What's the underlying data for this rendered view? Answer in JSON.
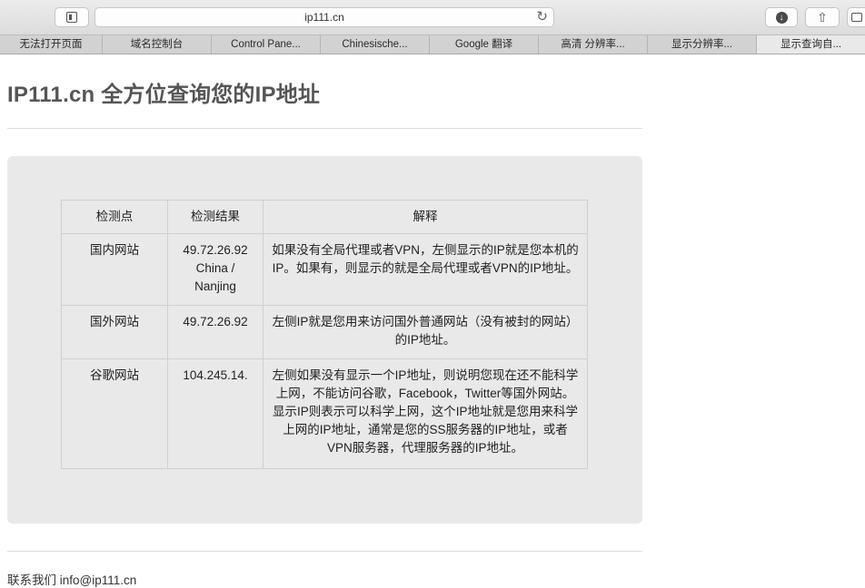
{
  "browser": {
    "url": "ip111.cn",
    "icons": {
      "sidebar": "sidebar-icon",
      "reload": "reload-icon",
      "download": "download-icon",
      "share": "share-icon",
      "tabs": "tabs-icon"
    }
  },
  "bookmarks": [
    {
      "label": "无法打开页面"
    },
    {
      "label": "域名控制台"
    },
    {
      "label": "Control Pane..."
    },
    {
      "label": "Chinesische..."
    },
    {
      "label": "Google 翻译"
    },
    {
      "label": "高清 分辨率..."
    },
    {
      "label": "显示分辨率..."
    },
    {
      "label": "显示查询自..."
    }
  ],
  "page": {
    "title": "IP111.cn 全方位查询您的IP地址",
    "table": {
      "headers": [
        "检测点",
        "检测结果",
        "解释"
      ],
      "rows": [
        {
          "point": "国内网站",
          "ip": "49.72.26.92",
          "location": "China / Nanjing",
          "explanation": "如果没有全局代理或者VPN，左侧显示的IP就是您本机的IP。如果有，则显示的就是全局代理或者VPN的IP地址。"
        },
        {
          "point": "国外网站",
          "ip": "49.72.26.92",
          "location": "",
          "explanation": "左侧IP就是您用来访问国外普通网站（没有被封的网站）的IP地址。"
        },
        {
          "point": "谷歌网站",
          "ip": "104.245.14.",
          "location": "",
          "explanation": "左侧如果没有显示一个IP地址，则说明您现在还不能科学上网，不能访问谷歌，Facebook，Twitter等国外网站。显示IP则表示可以科学上网，这个IP地址就是您用来科学上网的IP地址，通常是您的SS服务器的IP地址，或者VPN服务器，代理服务器的IP地址。"
        }
      ]
    },
    "footer": "联系我们 info@ip111.cn"
  },
  "colors": {
    "panel_bg": "#e9e9e9",
    "title_color": "#555555",
    "bookmarks_bg": "#d2d2d2"
  }
}
